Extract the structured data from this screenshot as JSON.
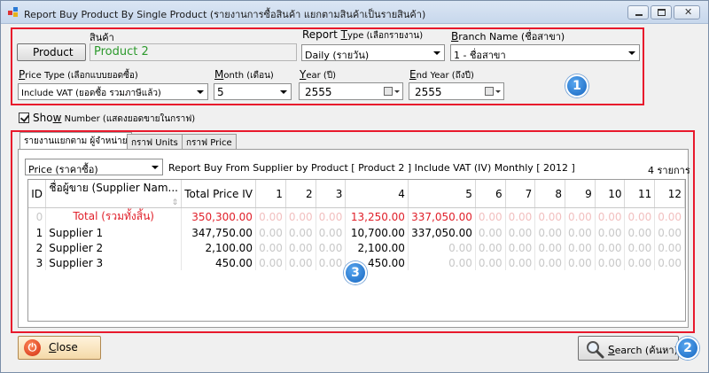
{
  "window": {
    "title": "Report Buy Product By Single Product (รายงานการซื้อสินค้า แยกตามสินค้าเป็นรายสินค้า)"
  },
  "filters": {
    "product_caption": "สินค้า",
    "product_button": "Product",
    "product_value": "Product 2",
    "report_type_label_pre": "Report ",
    "report_type_label_key": "T",
    "report_type_label_post": "ype (เลือกรายงาน)",
    "report_type_value": "Daily (รายวัน)",
    "branch_label_key": "B",
    "branch_label_post": "ranch Name (ชื่อสาขา)",
    "branch_value": "1 - ชื่อสาขา",
    "price_type_label_key": "P",
    "price_type_label_post": "rice Type (เลือกแบบยอดซื้อ)",
    "price_type_value": "Include VAT (ยอดซื้อ รวมภาษีแล้ว)",
    "month_label_key": "M",
    "month_label_post": "onth (เดือน)",
    "month_value": "5",
    "year_label_key": "Y",
    "year_label_post": "ear (ปี)",
    "year_value": "2555",
    "end_year_label_key": "E",
    "end_year_label_post": "nd Year (ถึงปี)",
    "end_year_value": "2555"
  },
  "show_number": {
    "label_pre": "Sho",
    "label_key": "w",
    "label_post": " Number (แสดงยอดขายในกราฟ)",
    "checked": true
  },
  "tabs": [
    {
      "label": "รายงานแยกตาม ผู้จำหน่าย"
    },
    {
      "label": "กราฟ Units"
    },
    {
      "label": "กราฟ Price"
    }
  ],
  "report": {
    "price_combo_value": "Price (ราคาซื้อ)",
    "heading": "Report Buy From Supplier by Product [ Product 2 ]  Include VAT (IV) Monthly [ 2012 ]",
    "item_count": "4 รายการ"
  },
  "grid": {
    "columns": [
      "ID",
      "ชื่อผู้ขาย (Supplier Nam...",
      "Total Price IV",
      "1",
      "2",
      "3",
      "4",
      "5",
      "6",
      "7",
      "8",
      "9",
      "10",
      "11",
      "12"
    ],
    "rows": [
      {
        "id": "0",
        "name": "Total  (รวมทั้งสิ้น)",
        "total": "350,300.00",
        "m": [
          "0.00",
          "0.00",
          "0.00",
          "13,250.00",
          "337,050.00",
          "0.00",
          "0.00",
          "0.00",
          "0.00",
          "0.00",
          "0.00",
          "0.00"
        ]
      },
      {
        "id": "1",
        "name": "Supplier 1",
        "total": "347,750.00",
        "m": [
          "0.00",
          "0.00",
          "0.00",
          "10,700.00",
          "337,050.00",
          "0.00",
          "0.00",
          "0.00",
          "0.00",
          "0.00",
          "0.00",
          "0.00"
        ]
      },
      {
        "id": "2",
        "name": "Supplier 2",
        "total": "2,100.00",
        "m": [
          "0.00",
          "0.00",
          "0.00",
          "2,100.00",
          "0.00",
          "0.00",
          "0.00",
          "0.00",
          "0.00",
          "0.00",
          "0.00",
          "0.00"
        ]
      },
      {
        "id": "3",
        "name": "Supplier 3",
        "total": "450.00",
        "m": [
          "0.00",
          "0.00",
          "0.00",
          "450.00",
          "0.00",
          "0.00",
          "0.00",
          "0.00",
          "0.00",
          "0.00",
          "0.00",
          "0.00"
        ]
      }
    ]
  },
  "buttons": {
    "close_key": "C",
    "close_post": "lose",
    "search_key": "S",
    "search_post": "earch (ค้นหา)"
  },
  "badges": [
    "1",
    "2",
    "3"
  ],
  "colors": {
    "highlight_red": "#e8192c",
    "badge_blue": "#1e78d8",
    "product_green": "#2d9a2d",
    "total_red": "#e0202a"
  }
}
